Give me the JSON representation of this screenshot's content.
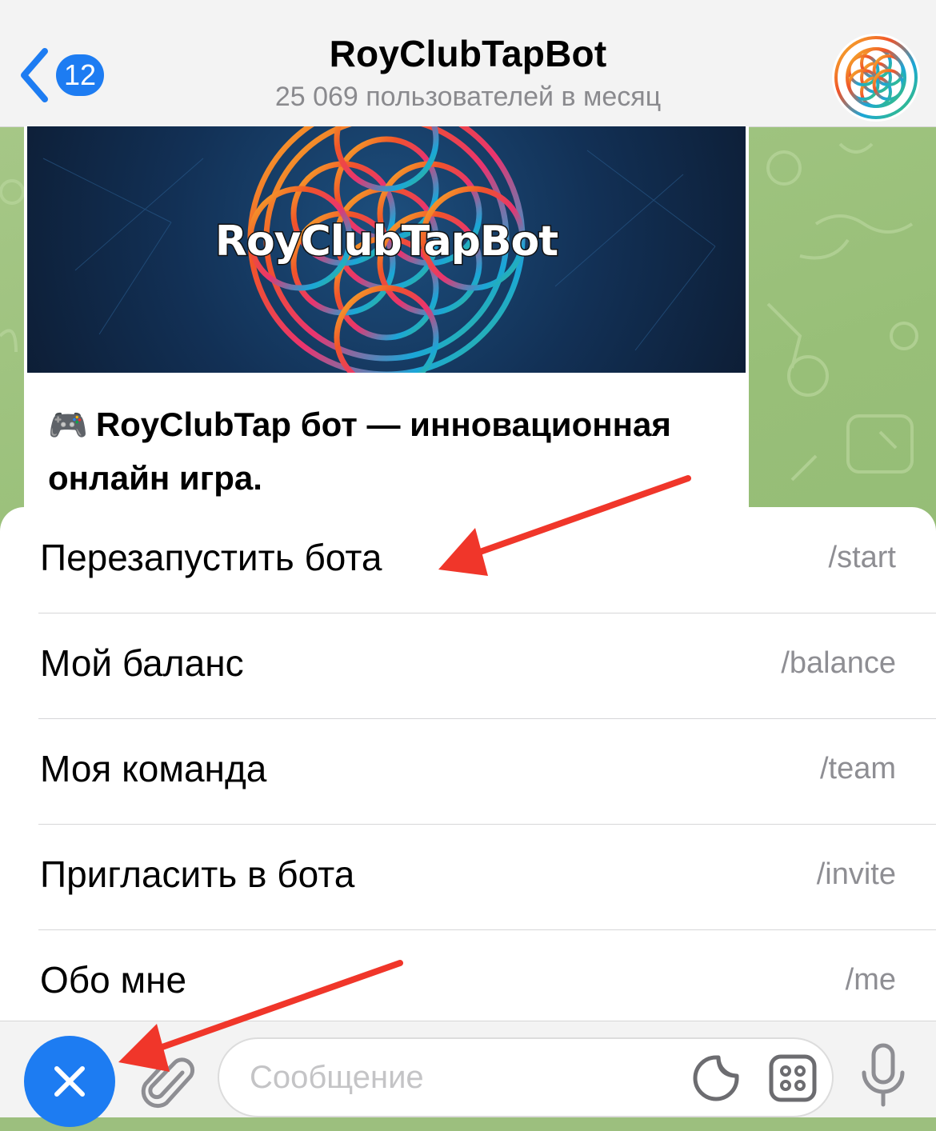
{
  "header": {
    "back_badge": "12",
    "title": "RoyClubTapBot",
    "subtitle": "25 069 пользователей в месяц"
  },
  "message": {
    "image_caption": "RoyClubTapBot",
    "emoji": "🎮",
    "text": "RoyClubTap бот — инновационная онлайн игра."
  },
  "commands": [
    {
      "label": "Перезапустить бота",
      "code": "/start"
    },
    {
      "label": "Мой баланс",
      "code": "/balance"
    },
    {
      "label": "Моя команда",
      "code": "/team"
    },
    {
      "label": "Пригласить в бота",
      "code": "/invite"
    },
    {
      "label": "Обо мне",
      "code": "/me"
    }
  ],
  "input": {
    "placeholder": "Сообщение"
  },
  "icons": {
    "back": "chevron-left-icon",
    "close": "close-icon",
    "attach": "paperclip-icon",
    "sticker": "sticker-icon",
    "commands": "bot-commands-icon",
    "mic": "microphone-icon"
  },
  "colors": {
    "accent": "#1d7cf2",
    "annotation_arrow": "#f0362a",
    "wallpaper": "#9cbf7e"
  }
}
